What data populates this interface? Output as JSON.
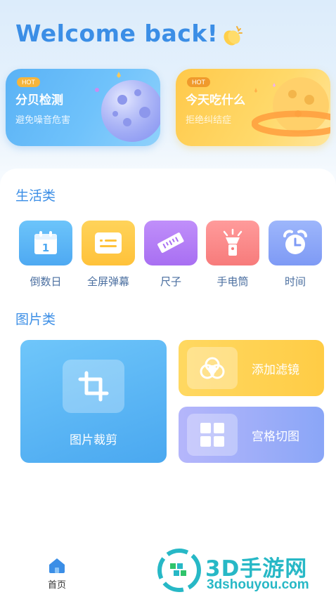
{
  "header": {
    "greeting": "Welcome back!",
    "emoji_icon": "clapping-hands-icon"
  },
  "promos": [
    {
      "badge": "HOT",
      "title": "分贝检测",
      "subtitle": "避免噪音危害"
    },
    {
      "badge": "HOT",
      "title": "今天吃什么",
      "subtitle": "拒绝纠结症"
    }
  ],
  "life": {
    "title": "生活类",
    "tools": [
      {
        "label": "倒数日",
        "icon": "calendar-icon",
        "color": "#5bb6f6"
      },
      {
        "label": "全屏弹幕",
        "icon": "message-icon",
        "color": "#ffc94a"
      },
      {
        "label": "尺子",
        "icon": "ruler-icon",
        "color": "#b07ef5"
      },
      {
        "label": "手电筒",
        "icon": "flashlight-icon",
        "color": "#f98484"
      },
      {
        "label": "时间",
        "icon": "alarm-clock-icon",
        "color": "#8ba3f7"
      }
    ]
  },
  "image": {
    "title": "图片类",
    "crop": {
      "label": "图片裁剪",
      "icon": "crop-icon"
    },
    "filter": {
      "label": "添加滤镜",
      "icon": "filter-icon"
    },
    "grid": {
      "label": "宫格切图",
      "icon": "grid-icon"
    }
  },
  "tabbar": {
    "home_label": "首页",
    "home_icon": "home-icon"
  },
  "watermark": {
    "title": "3D手游网",
    "url": "3dshouyou.com"
  },
  "colors": {
    "accent": "#3b8ee6",
    "blue_card": "#5ab2f5",
    "yellow_card": "#ffc94a"
  }
}
